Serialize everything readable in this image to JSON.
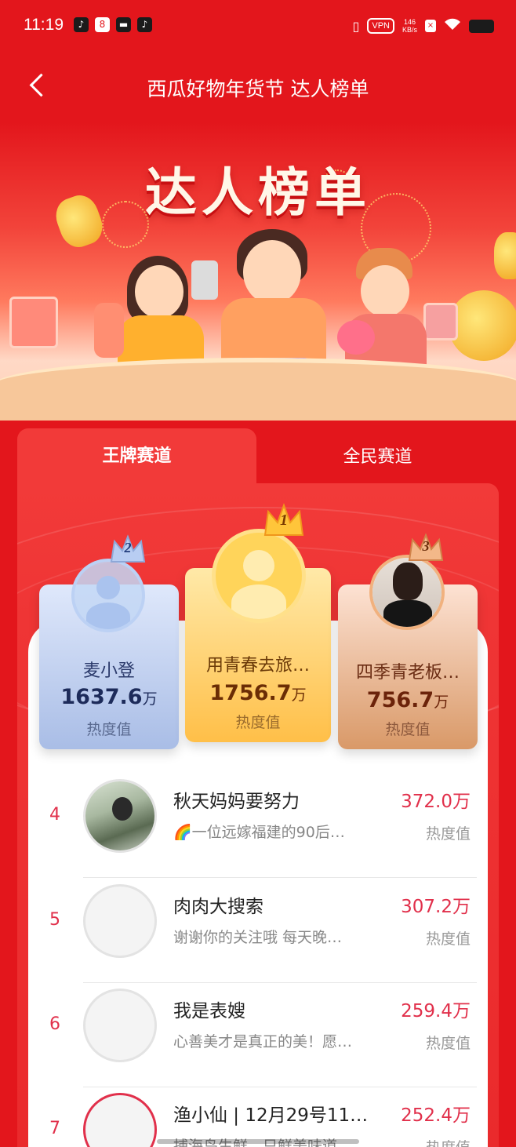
{
  "status_bar": {
    "time": "11:19",
    "vpn": "VPN",
    "net_speed_value": "146",
    "net_speed_unit": "KB/s"
  },
  "nav": {
    "title": "西瓜好物年货节 达人榜单"
  },
  "banner": {
    "title": "达人榜单"
  },
  "tabs": [
    {
      "label": "王牌赛道",
      "active": true
    },
    {
      "label": "全民赛道",
      "active": false
    }
  ],
  "podium": [
    {
      "rank": "2",
      "name": "麦小登",
      "score": "1637.6",
      "unit": "万",
      "label": "热度值"
    },
    {
      "rank": "1",
      "name": "用青春去旅…",
      "score": "1756.7",
      "unit": "万",
      "label": "热度值"
    },
    {
      "rank": "3",
      "name": "四季青老板…",
      "score": "756.7",
      "unit": "万",
      "label": "热度值"
    }
  ],
  "list": [
    {
      "rank": "4",
      "name": "秋天妈妈要努力",
      "desc": "🌈一位远嫁福建的90后…",
      "score": "372.0万",
      "label": "热度值"
    },
    {
      "rank": "5",
      "name": "肉肉大搜索",
      "desc": "谢谢你的关注哦 每天晚…",
      "score": "307.2万",
      "label": "热度值"
    },
    {
      "rank": "6",
      "name": "我是表嫂",
      "desc": "心善美才是真正的美！愿…",
      "score": "259.4万",
      "label": "热度值"
    },
    {
      "rank": "7",
      "name": "渔小仙 | 12月29号11…",
      "desc": "捕海鸟生鲜，只鲜美味道…",
      "score": "252.4万",
      "label": "热度值"
    }
  ],
  "colors": {
    "primary_red": "#e3161c",
    "accent_pink": "#e1304b",
    "gold": "#ffbf48"
  }
}
